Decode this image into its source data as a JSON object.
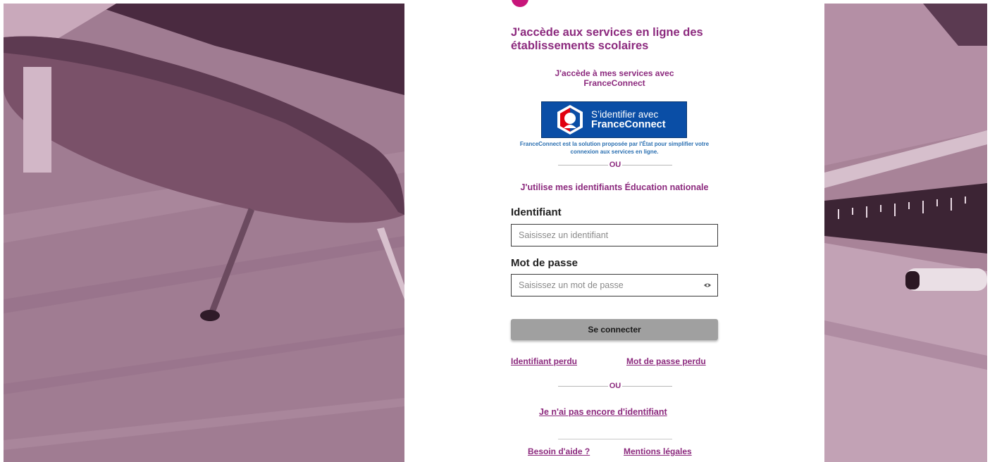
{
  "page": {
    "title": "J'accède aux services en ligne des établissements scolaires"
  },
  "franceconnect": {
    "heading": "J'accède à mes services avec FranceConnect",
    "button_line1": "S’identifier avec",
    "button_line2": "FranceConnect",
    "note": "FranceConnect est la solution proposée par l'État pour simplifier votre connexion aux services en ligne."
  },
  "separator_word": "OU",
  "education_nationale": {
    "heading": "J'utilise mes identifiants Éducation nationale"
  },
  "form": {
    "id_label": "Identifiant",
    "id_placeholder": "Saisissez un identifiant",
    "id_value": "",
    "pw_label": "Mot de passe",
    "pw_placeholder": "Saisissez un mot de passe",
    "pw_value": "",
    "submit_label": "Se connecter"
  },
  "links": {
    "lost_id": "Identifiant perdu",
    "lost_pw": "Mot de passe perdu",
    "no_id": "Je n'ai pas encore d'identifiant",
    "help": "Besoin d'aide ?",
    "legal": "Mentions légales"
  },
  "icons": {
    "franceconnect_logo": "franceconnect-logo-icon",
    "show_password": "eye-icon"
  },
  "colors": {
    "accent": "#8c2a7e",
    "franceconnect_blue": "#0a4ea6",
    "note_blue": "#2a6fb1",
    "submit_gray": "#a0a0a0",
    "photo_tint": "#9a6f8a"
  }
}
